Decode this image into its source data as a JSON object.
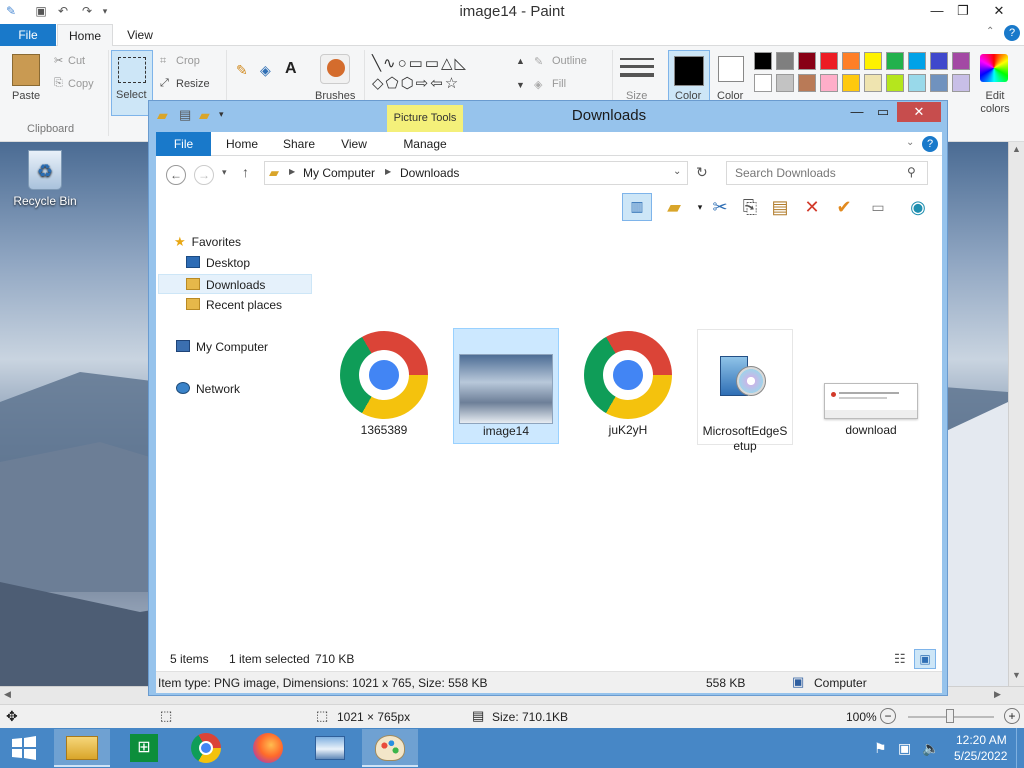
{
  "paint": {
    "title": "image14 - Paint",
    "tabs": {
      "file": "File",
      "home": "Home",
      "view": "View"
    },
    "clipboard": {
      "paste": "Paste",
      "cut": "Cut",
      "copy": "Copy",
      "group": "Clipboard"
    },
    "image": {
      "select": "Select",
      "crop": "Crop",
      "resize": "Resize"
    },
    "tools": {
      "brushes": "Brushes",
      "text_tool": "A"
    },
    "shapes": {
      "outline": "Outline",
      "fill": "Fill",
      "size": "Size"
    },
    "colors": {
      "color1": "Color",
      "color2": "Color",
      "edit_colors": "Edit colors",
      "palette": [
        "#000000",
        "#7f7f7f",
        "#880015",
        "#ed1c24",
        "#ff7f27",
        "#fff200",
        "#22b14c",
        "#00a2e8",
        "#3f48cc",
        "#a349a4",
        "#ffffff",
        "#c3c3c3",
        "#b97a57",
        "#ffaec9",
        "#ffc90e",
        "#efe4b0",
        "#b5e61d",
        "#99d9ea",
        "#7092be",
        "#c8bfe7"
      ]
    },
    "status": {
      "dimensions": "1021 × 765px",
      "size": "Size: 710.1KB",
      "zoom": "100%"
    }
  },
  "desktop": {
    "recycle_bin": "Recycle Bin"
  },
  "explorer": {
    "title": "Downloads",
    "picture_tools": "Picture Tools",
    "tabs": {
      "file": "File",
      "home": "Home",
      "share": "Share",
      "view": "View",
      "manage": "Manage"
    },
    "breadcrumb": {
      "root": "My Computer",
      "current": "Downloads"
    },
    "search_placeholder": "Search Downloads",
    "nav": {
      "favorites": "Favorites",
      "desktop": "Desktop",
      "downloads": "Downloads",
      "recent": "Recent places",
      "my_computer": "My Computer",
      "network": "Network"
    },
    "files": [
      {
        "name": "1365389",
        "type": "chrome"
      },
      {
        "name": "image14",
        "type": "image"
      },
      {
        "name": "juK2yH",
        "type": "chrome"
      },
      {
        "name": "MicrosoftEdgeSetup",
        "type": "installer"
      },
      {
        "name": "download",
        "type": "screenshot"
      }
    ],
    "status": {
      "items": "5 items",
      "selected": "1 item selected",
      "sel_size": "710 KB"
    },
    "details": {
      "info": "Item type: PNG image, Dimensions: 1021 x 765, Size: 558 KB",
      "size": "558 KB",
      "location": "Computer"
    }
  },
  "taskbar": {
    "time": "12:20 AM",
    "date": "5/25/2022"
  }
}
